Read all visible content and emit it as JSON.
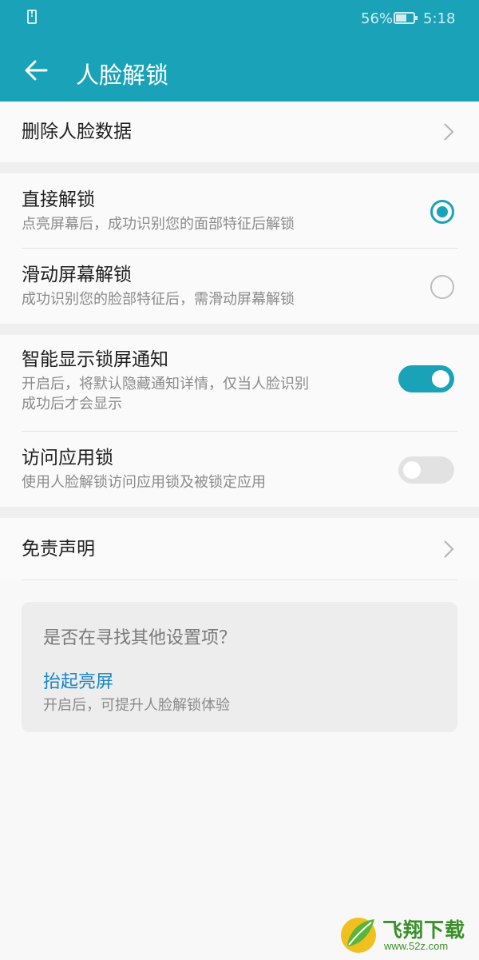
{
  "status_bar": {
    "battery_percent": "56%",
    "time": "5:18"
  },
  "header": {
    "title": "人脸解锁"
  },
  "rows": {
    "delete_face": "删除人脸数据",
    "direct_unlock": {
      "title": "直接解锁",
      "subtitle": "点亮屏幕后，成功识别您的面部特征后解锁",
      "selected": true
    },
    "swipe_unlock": {
      "title": "滑动屏幕解锁",
      "subtitle": "成功识别您的脸部特征后，需滑动屏幕解锁",
      "selected": false
    },
    "smart_notification": {
      "title": "智能显示锁屏通知",
      "subtitle_line1": "开启后，将默认隐藏通知详情，仅当人脸识别",
      "subtitle_line2": "成功后才会显示",
      "enabled": true
    },
    "app_lock": {
      "title": "访问应用锁",
      "subtitle": "使用人脸解锁访问应用锁及被锁定应用",
      "enabled": false
    },
    "disclaimer": "免责声明"
  },
  "suggestion": {
    "heading": "是否在寻找其他设置项？",
    "link": "抬起亮屏",
    "subtitle": "开启后，可提升人脸解锁体验"
  },
  "watermark": {
    "brand": "飞翔下载",
    "url": "www.52z.com"
  },
  "colors": {
    "accent": "#1aa3b8",
    "link": "#1a83c4"
  }
}
